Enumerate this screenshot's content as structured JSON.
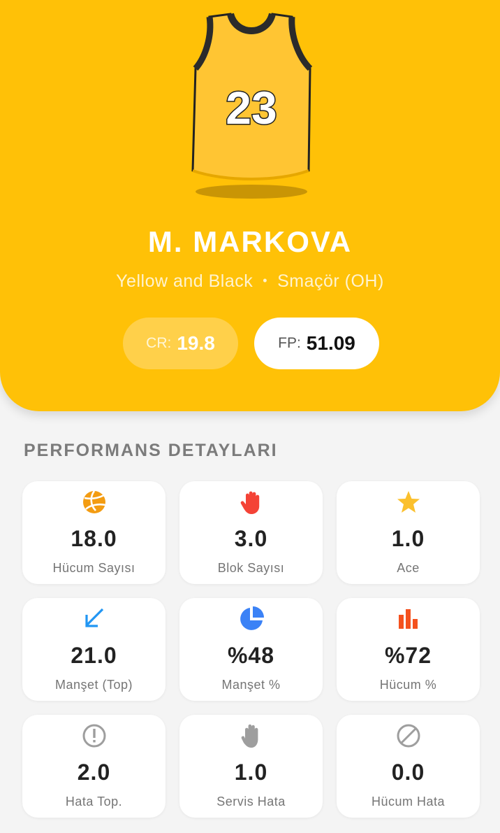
{
  "player": {
    "jersey_number": "23",
    "name": "M. MARKOVA",
    "team": "Yellow and Black",
    "separator": "•",
    "position": "Smaçör (OH)",
    "cr_label": "CR:",
    "cr_value": "19.8",
    "fp_label": "FP:",
    "fp_value": "51.09"
  },
  "colors": {
    "accent": "#ffc107",
    "jersey_body": "#ffc533",
    "jersey_trim": "#2b2b2b",
    "attack_icon": "#f39c12",
    "block_icon": "#f44336",
    "ace_icon": "#fbc02d",
    "reception_icon": "#2196f3",
    "pie_icon": "#3b82f6",
    "bar_icon": "#f4511e",
    "error_icon": "#9e9e9e"
  },
  "section": {
    "title": "PERFORMANS DETAYLARI"
  },
  "stats": [
    {
      "icon": "volleyball-icon",
      "value": "18.0",
      "label": "Hücum Sayısı"
    },
    {
      "icon": "hand-block-icon",
      "value": "3.0",
      "label": "Blok Sayısı"
    },
    {
      "icon": "star-icon",
      "value": "1.0",
      "label": "Ace"
    },
    {
      "icon": "arrow-down-left-icon",
      "value": "21.0",
      "label": "Manşet (Top)"
    },
    {
      "icon": "pie-chart-icon",
      "value": "%48",
      "label": "Manşet %"
    },
    {
      "icon": "bar-chart-icon",
      "value": "%72",
      "label": "Hücum %"
    },
    {
      "icon": "exclamation-circle-icon",
      "value": "2.0",
      "label": "Hata Top."
    },
    {
      "icon": "hand-icon",
      "value": "1.0",
      "label": "Servis Hata"
    },
    {
      "icon": "block-circle-icon",
      "value": "0.0",
      "label": "Hücum Hata"
    }
  ]
}
